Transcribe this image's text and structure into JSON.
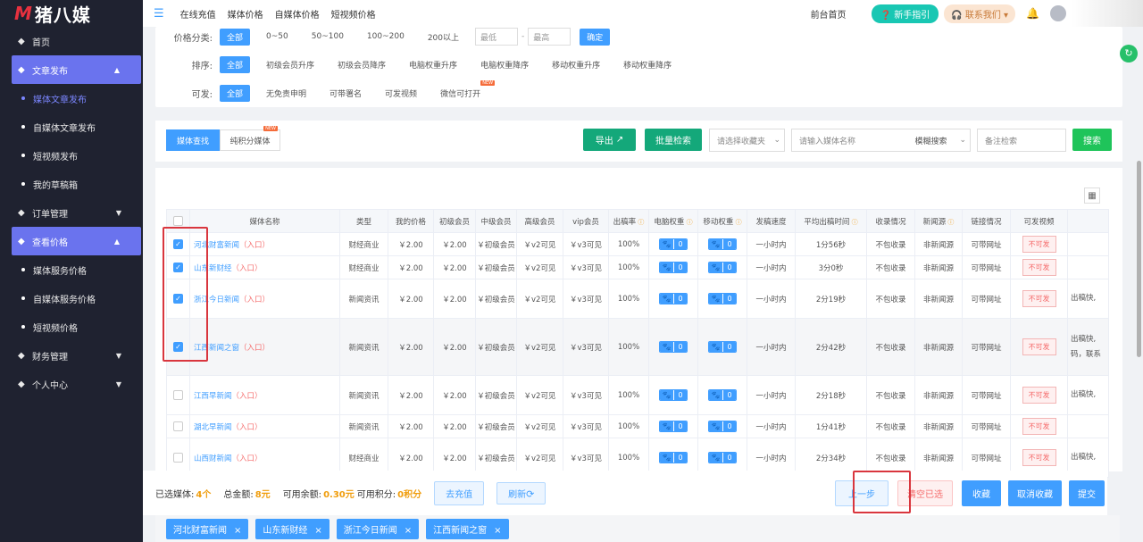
{
  "sidebar": {
    "logo_mark": "M",
    "logo_text": "猪八媒",
    "items": [
      {
        "label": "首页",
        "icon": "home-icon",
        "type": "top"
      },
      {
        "label": "文章发布",
        "icon": "doc-icon",
        "type": "active",
        "caret": "▲"
      },
      {
        "label": "媒体文章发布",
        "type": "sub-cur"
      },
      {
        "label": "自媒体文章发布",
        "type": "sub"
      },
      {
        "label": "短视频发布",
        "type": "sub"
      },
      {
        "label": "我的草稿箱",
        "type": "sub"
      },
      {
        "label": "订单管理",
        "icon": "order-icon",
        "type": "top",
        "caret": "▼"
      },
      {
        "label": "查看价格",
        "icon": "price-icon",
        "type": "active",
        "caret": "▲"
      },
      {
        "label": "媒体服务价格",
        "type": "sub"
      },
      {
        "label": "自媒体服务价格",
        "type": "sub"
      },
      {
        "label": "短视频价格",
        "type": "sub"
      },
      {
        "label": "财务管理",
        "icon": "finance-icon",
        "type": "top",
        "caret": "▼"
      },
      {
        "label": "个人中心",
        "icon": "user-icon",
        "type": "top",
        "caret": "▼"
      }
    ]
  },
  "topbar": {
    "links": [
      "在线充值",
      "媒体价格",
      "自媒体价格",
      "短视频价格"
    ],
    "front": "前台首页",
    "guide": "新手指引",
    "contact": "联系我们"
  },
  "filters": {
    "price": {
      "label": "价格分类:",
      "options": [
        "全部",
        "0~50",
        "50~100",
        "100~200",
        "200以上"
      ],
      "min_ph": "最低",
      "dash": "-",
      "max_ph": "最高",
      "ok": "确定"
    },
    "sort": {
      "label": "排序:",
      "options": [
        "全部",
        "初级会员升序",
        "初级会员降序",
        "电脑权重升序",
        "电脑权重降序",
        "移动权重升序",
        "移动权重降序"
      ]
    },
    "can": {
      "label": "可发:",
      "options": [
        "全部",
        "无免责申明",
        "可带署名",
        "可发视频",
        "微信可打开"
      ],
      "new_badge": "NEW"
    }
  },
  "toolbar": {
    "tab1": "媒体查找",
    "tab2": "纯积分媒体",
    "new": "NEW",
    "export": "导出",
    "batch": "批量检索",
    "fav_ph": "请选择收藏夹",
    "name_ph": "请输入媒体名称",
    "fuzzy": "模糊搜索",
    "remark_ph": "备注检索",
    "search": "搜索"
  },
  "table": {
    "headers": [
      "",
      "媒体名称",
      "类型",
      "我的价格",
      "初级会员",
      "中级会员",
      "高级会员",
      "vip会员",
      "出稿率",
      "电脑权重",
      "移动权重",
      "发稿速度",
      "平均出稿时间",
      "收录情况",
      "新闻源",
      "链接情况",
      "可发视频",
      ""
    ],
    "entry": "（入口）",
    "rows": [
      {
        "checked": true,
        "name": "河北财富新闻",
        "type": "财经商业",
        "my": "￥2.00",
        "c1": "￥2.00",
        "c2": "￥初级会员",
        "c3": "￥v2可见",
        "c4": "￥v3可见",
        "rate": "100%",
        "pc": "0",
        "mb": "0",
        "speed": "一小时内",
        "avg": "1分56秒",
        "inc": "不包收录",
        "src": "非新闻源",
        "link": "可带网址",
        "video": "不可发",
        "note": "",
        "h": 26
      },
      {
        "checked": true,
        "name": "山东新财经",
        "type": "财经商业",
        "my": "￥2.00",
        "c1": "￥2.00",
        "c2": "￥初级会员",
        "c3": "￥v2可见",
        "c4": "￥v3可见",
        "rate": "100%",
        "pc": "0",
        "mb": "0",
        "speed": "一小时内",
        "avg": "3分0秒",
        "inc": "不包收录",
        "src": "非新闻源",
        "link": "可带网址",
        "video": "不可发",
        "note": "",
        "h": 26
      },
      {
        "checked": true,
        "name": "浙江今日新闻",
        "type": "新闻资讯",
        "my": "￥2.00",
        "c1": "￥2.00",
        "c2": "￥初级会员",
        "c3": "￥v2可见",
        "c4": "￥v3可见",
        "rate": "100%",
        "pc": "0",
        "mb": "0",
        "speed": "一小时内",
        "avg": "2分19秒",
        "inc": "不包收录",
        "src": "非新闻源",
        "link": "可带网址",
        "video": "不可发",
        "note": "出稿快,",
        "h": 44
      },
      {
        "checked": true,
        "name": "江西新闻之窗",
        "type": "新闻资讯",
        "my": "￥2.00",
        "c1": "￥2.00",
        "c2": "￥初级会员",
        "c3": "￥v2可见",
        "c4": "￥v3可见",
        "rate": "100%",
        "pc": "0",
        "mb": "0",
        "speed": "一小时内",
        "avg": "2分42秒",
        "inc": "不包收录",
        "src": "非新闻源",
        "link": "可带网址",
        "video": "不可发",
        "note": "出稿快,码，联系",
        "h": 64,
        "hl": true
      },
      {
        "checked": false,
        "name": "江西早新闻",
        "type": "新闻资讯",
        "my": "￥2.00",
        "c1": "￥2.00",
        "c2": "￥初级会员",
        "c3": "￥v2可见",
        "c4": "￥v3可见",
        "rate": "100%",
        "pc": "0",
        "mb": "0",
        "speed": "一小时内",
        "avg": "2分18秒",
        "inc": "不包收录",
        "src": "非新闻源",
        "link": "可带网址",
        "video": "不可发",
        "note": "出稿快,",
        "h": 44
      },
      {
        "checked": false,
        "name": "湖北早新闻",
        "type": "新闻资讯",
        "my": "￥2.00",
        "c1": "￥2.00",
        "c2": "￥初级会员",
        "c3": "￥v2可见",
        "c4": "￥v3可见",
        "rate": "100%",
        "pc": "0",
        "mb": "0",
        "speed": "一小时内",
        "avg": "1分41秒",
        "inc": "不包收录",
        "src": "非新闻源",
        "link": "可带网址",
        "video": "不可发",
        "note": "",
        "h": 26
      },
      {
        "checked": false,
        "name": "山西财新闻",
        "type": "财经商业",
        "my": "￥2.00",
        "c1": "￥2.00",
        "c2": "￥初级会员",
        "c3": "￥v2可见",
        "c4": "￥v3可见",
        "rate": "100%",
        "pc": "0",
        "mb": "0",
        "speed": "一小时内",
        "avg": "2分34秒",
        "inc": "不包收录",
        "src": "非新闻源",
        "link": "可带网址",
        "video": "不可发",
        "note": "出稿快,",
        "h": 44
      }
    ]
  },
  "bottom": {
    "sel_label": "已选媒体:",
    "sel": "4个",
    "total_label": "总金额:",
    "total": "8元",
    "bal_label": "可用余额:",
    "bal": "0.30元",
    "pts_label": "可用积分:",
    "pts": "0积分",
    "recharge": "去充值",
    "refresh": "刷新",
    "prev": "上一步",
    "clear": "清空已选",
    "fav": "收藏",
    "unfav": "取消收藏",
    "submit": "提交"
  },
  "chips": [
    "河北财富新闻",
    "山东新财经",
    "浙江今日新闻",
    "江西新闻之窗"
  ],
  "colors": {
    "accent": "#409eff",
    "sidebar": "#1f2230",
    "active": "#6a73ee",
    "green": "#14a87a",
    "danger": "#d9363e"
  }
}
